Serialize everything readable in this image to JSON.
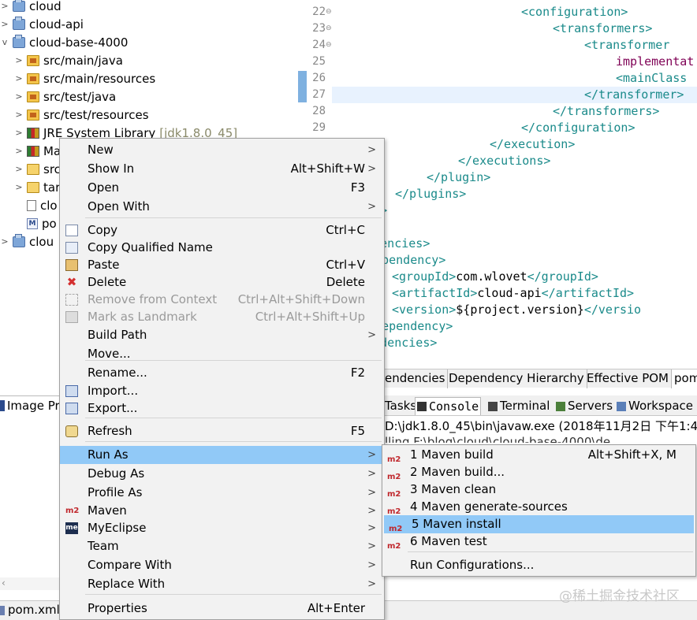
{
  "tree": [
    {
      "arrow": ">",
      "icon": "project",
      "label": "cloud"
    },
    {
      "arrow": ">",
      "icon": "project",
      "label": "cloud-api"
    },
    {
      "arrow": "v",
      "icon": "project",
      "label": "cloud-base-4000"
    },
    {
      "arrow": ">",
      "icon": "package",
      "label": "src/main/java"
    },
    {
      "arrow": ">",
      "icon": "package",
      "label": "src/main/resources"
    },
    {
      "arrow": ">",
      "icon": "package",
      "label": "src/test/java"
    },
    {
      "arrow": ">",
      "icon": "package",
      "label": "src/test/resources"
    },
    {
      "arrow": ">",
      "icon": "library",
      "label": "JRE System Library",
      "extra": "[jdk1.8.0_45]"
    },
    {
      "arrow": ">",
      "icon": "library",
      "label": "Ma"
    },
    {
      "arrow": ">",
      "icon": "folder",
      "label": "src"
    },
    {
      "arrow": ">",
      "icon": "folder",
      "label": "tar"
    },
    {
      "arrow": "",
      "icon": "file",
      "label": "clo"
    },
    {
      "arrow": "",
      "icon": "mfile",
      "label": "po"
    },
    {
      "arrow": ">",
      "icon": "project",
      "label": "clou"
    }
  ],
  "editor": {
    "line_numbers": [
      "22",
      "23",
      "24",
      "25",
      "26",
      "27",
      "28",
      "29"
    ],
    "lines": [
      {
        "indent": "          ",
        "open": "<configuration>",
        "text": "",
        "close": ""
      },
      {
        "indent": "              ",
        "open": "<transformers>",
        "text": "",
        "close": ""
      },
      {
        "indent": "                  ",
        "open": "<transformer",
        "text": "",
        "close": ""
      },
      {
        "indent": "                      ",
        "open": "",
        "text": "implementat",
        "close": ""
      },
      {
        "indent": "                      ",
        "open": "<mainClass",
        "text": "",
        "close": ""
      },
      {
        "indent": "                  ",
        "open": "</transformer>",
        "text": "",
        "close": ""
      },
      {
        "indent": "              ",
        "open": "</transformers>",
        "text": "",
        "close": ""
      },
      {
        "indent": "          ",
        "open": "</configuration>",
        "text": "",
        "close": ""
      },
      {
        "indent": "      ",
        "open": "</execution>",
        "text": "",
        "close": ""
      },
      {
        "indent": "   ",
        "open": "</executions>",
        "text": "",
        "close": ""
      },
      {
        "indent": "",
        "open": "</plugin>",
        "text": "",
        "close": ""
      },
      {
        "indent": "",
        "open": "</plugins>",
        "text": "",
        "close": ""
      },
      {
        "indent": "",
        "open": "build>",
        "text": "",
        "close": ""
      },
      {
        "indent": "",
        "open": "",
        "text": "",
        "close": ""
      },
      {
        "indent": "",
        "open": "ependencies>",
        "text": "",
        "close": ""
      },
      {
        "indent": "",
        "open": "<dependency>",
        "text": "",
        "close": ""
      },
      {
        "indent": "",
        "open": "<groupId>",
        "text": "com.wlovet",
        "close": "</groupId>"
      },
      {
        "indent": "",
        "open": "<artifactId>",
        "text": "cloud-api",
        "close": "</artifactId>"
      },
      {
        "indent": "",
        "open": "<version>",
        "text": "${project.version}",
        "close": "</versio"
      },
      {
        "indent": "",
        "open": "</dependency>",
        "text": "",
        "close": ""
      },
      {
        "indent": "",
        "open": "dependencies>",
        "text": "",
        "close": ""
      }
    ],
    "tabs": [
      "endencies",
      "Dependency Hierarchy",
      "Effective POM",
      "pom"
    ]
  },
  "image_preview_tab": "Image Pr",
  "console": {
    "tabs": [
      "Tasks",
      "Console",
      "Terminal",
      "Servers",
      "Workspace"
    ],
    "line1": "D:\\jdk1.8.0_45\\bin\\javaw.exe (2018年11月2日 下午1:47:5",
    "line2": "lling F:\\blog\\cloud\\cloud-base-4000\\de"
  },
  "bottom_tab": "pom.xml",
  "watermark": "@稀土掘金技术社区",
  "context_menu": {
    "items": [
      {
        "label": "New",
        "accel": "",
        "submenu": true,
        "icon": "",
        "disabled": false
      },
      {
        "label": "Show In",
        "accel": "Alt+Shift+W",
        "submenu": true,
        "icon": "",
        "disabled": false
      },
      {
        "label": "Open",
        "accel": "F3",
        "submenu": false,
        "icon": "",
        "disabled": false
      },
      {
        "label": "Open With",
        "accel": "",
        "submenu": true,
        "icon": "",
        "disabled": false
      },
      {
        "label": "Copy",
        "accel": "Ctrl+C",
        "submenu": false,
        "icon": "copy-icon",
        "disabled": false
      },
      {
        "label": "Copy Qualified Name",
        "accel": "",
        "submenu": false,
        "icon": "copy-qualified-icon",
        "disabled": false
      },
      {
        "label": "Paste",
        "accel": "Ctrl+V",
        "submenu": false,
        "icon": "paste-icon",
        "disabled": false
      },
      {
        "label": "Delete",
        "accel": "Delete",
        "submenu": false,
        "icon": "delete-icon",
        "disabled": false
      },
      {
        "label": "Remove from Context",
        "accel": "Ctrl+Alt+Shift+Down",
        "submenu": false,
        "icon": "remove-context-icon",
        "disabled": true
      },
      {
        "label": "Mark as Landmark",
        "accel": "Ctrl+Alt+Shift+Up",
        "submenu": false,
        "icon": "landmark-icon",
        "disabled": true
      },
      {
        "label": "Build Path",
        "accel": "",
        "submenu": true,
        "icon": "",
        "disabled": false
      },
      {
        "label": "Move...",
        "accel": "",
        "submenu": false,
        "icon": "",
        "disabled": false
      },
      {
        "label": "Rename...",
        "accel": "F2",
        "submenu": false,
        "icon": "",
        "disabled": false
      },
      {
        "label": "Import...",
        "accel": "",
        "submenu": false,
        "icon": "import-icon",
        "disabled": false
      },
      {
        "label": "Export...",
        "accel": "",
        "submenu": false,
        "icon": "export-icon",
        "disabled": false
      },
      {
        "label": "Refresh",
        "accel": "F5",
        "submenu": false,
        "icon": "refresh-icon",
        "disabled": false
      },
      {
        "label": "Run As",
        "accel": "",
        "submenu": true,
        "icon": "",
        "disabled": false,
        "selected": true
      },
      {
        "label": "Debug As",
        "accel": "",
        "submenu": true,
        "icon": "",
        "disabled": false
      },
      {
        "label": "Profile As",
        "accel": "",
        "submenu": true,
        "icon": "",
        "disabled": false
      },
      {
        "label": "Maven",
        "accel": "",
        "submenu": true,
        "icon": "m2-icon",
        "disabled": false
      },
      {
        "label": "MyEclipse",
        "accel": "",
        "submenu": true,
        "icon": "me-icon",
        "disabled": false
      },
      {
        "label": "Team",
        "accel": "",
        "submenu": true,
        "icon": "",
        "disabled": false
      },
      {
        "label": "Compare With",
        "accel": "",
        "submenu": true,
        "icon": "",
        "disabled": false
      },
      {
        "label": "Replace With",
        "accel": "",
        "submenu": true,
        "icon": "",
        "disabled": false
      },
      {
        "label": "Properties",
        "accel": "Alt+Enter",
        "submenu": false,
        "icon": "",
        "disabled": false
      }
    ],
    "submenu_glyph": ">",
    "m2_badge": "m2",
    "me_badge": "me"
  },
  "run_as_submenu": {
    "items": [
      {
        "label": "1 Maven build",
        "accel": "Alt+Shift+X, M",
        "icon": "m2-icon"
      },
      {
        "label": "2 Maven build...",
        "accel": "",
        "icon": "m2-icon"
      },
      {
        "label": "3 Maven clean",
        "accel": "",
        "icon": "m2-icon"
      },
      {
        "label": "4 Maven generate-sources",
        "accel": "",
        "icon": "m2-icon"
      },
      {
        "label": "5 Maven install",
        "accel": "",
        "icon": "m2-icon",
        "selected": true
      },
      {
        "label": "6 Maven test",
        "accel": "",
        "icon": "m2-icon"
      },
      {
        "label": "Run Configurations...",
        "accel": "",
        "icon": ""
      }
    ]
  },
  "colors": {
    "selection": "#91c9f7",
    "xml_tag": "#1a8a8a",
    "xml_attr": "#7f0055",
    "maven_red": "#c0282d"
  }
}
